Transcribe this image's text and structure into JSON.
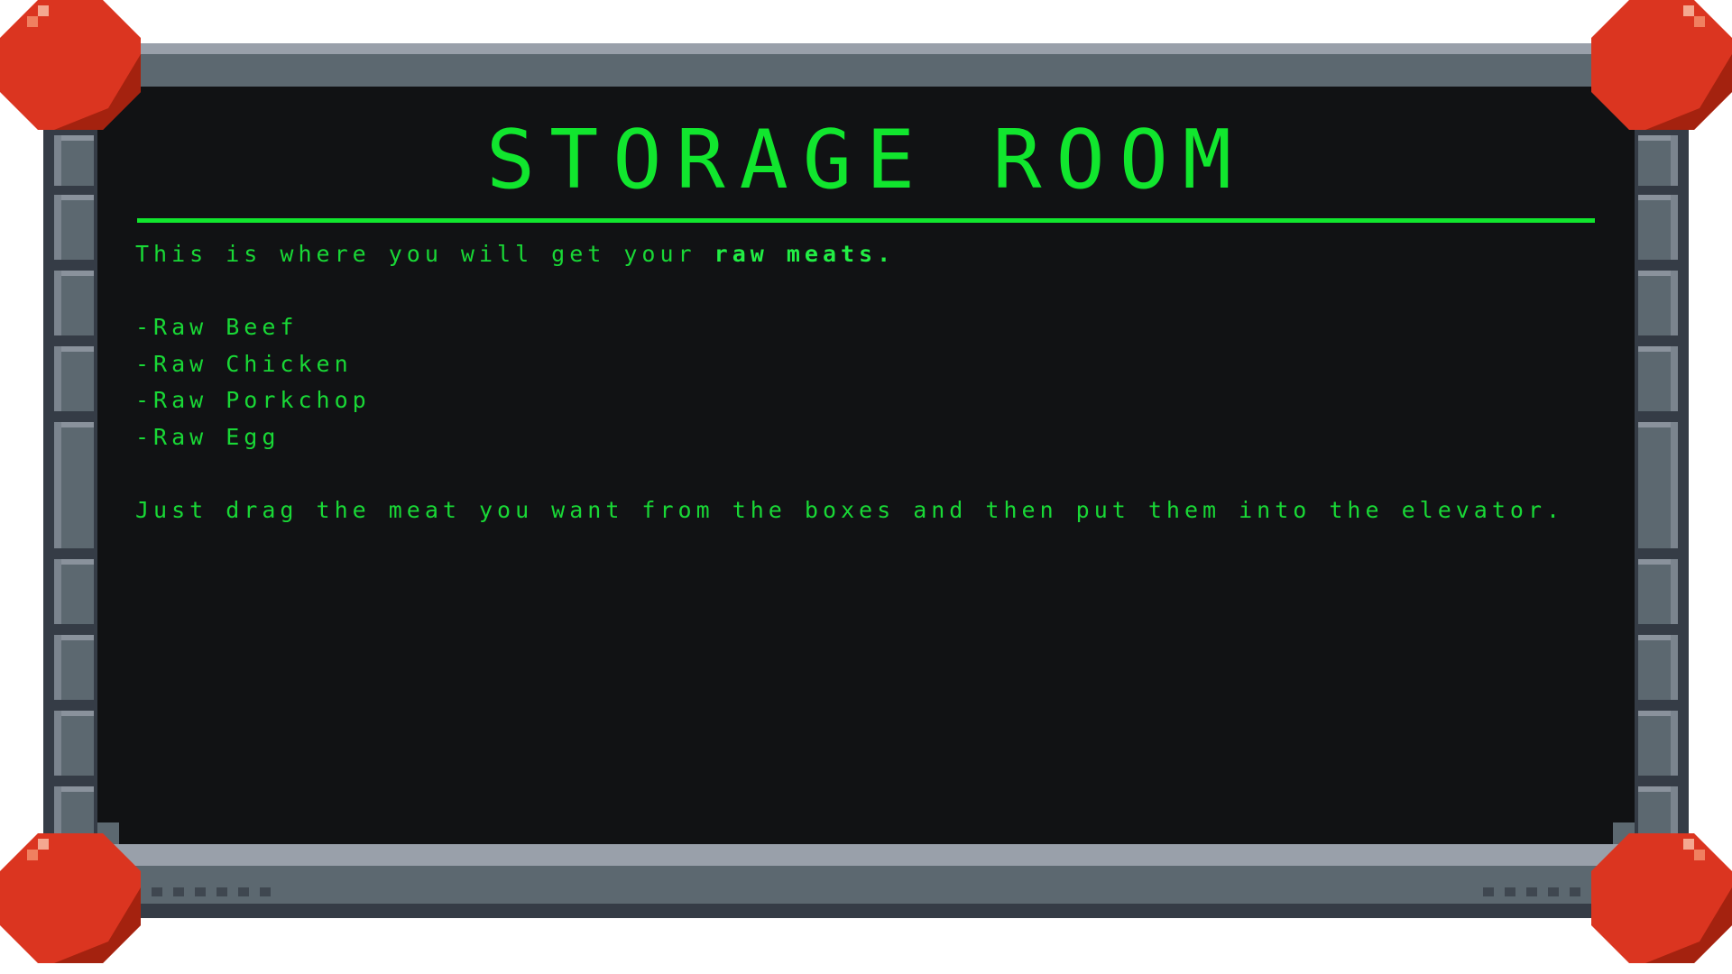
{
  "screen": {
    "title": "STORAGE ROOM",
    "intro_prefix": "This is where you will get your ",
    "intro_emphasis": "raw meats.",
    "items": [
      "-Raw Beef",
      "-Raw Chicken",
      "-Raw Porkchop",
      "-Raw Egg"
    ],
    "instructions": "Just drag the meat you want from the boxes and then put them into the elevator."
  },
  "colors": {
    "terminal_green": "#11e62e",
    "screen_bg": "#111214",
    "frame_metal": "#5c6870",
    "frame_light": "#99a0aa",
    "bolt_red": "#db3520"
  },
  "icons": {
    "corner_bolts": "red-bolt-icon"
  }
}
